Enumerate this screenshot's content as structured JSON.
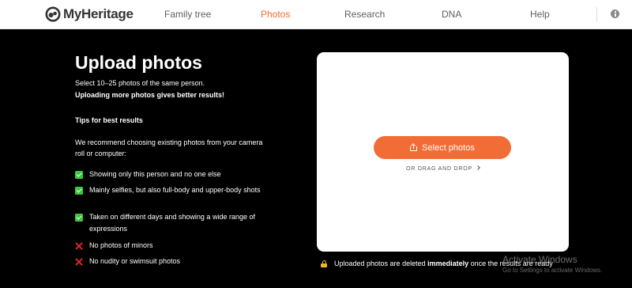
{
  "header": {
    "logo_text": "MyHeritage",
    "nav": [
      {
        "label": "Family tree"
      },
      {
        "label": "Photos",
        "active": true
      },
      {
        "label": "Research"
      },
      {
        "label": "DNA"
      },
      {
        "label": "Help"
      }
    ],
    "icons": {
      "logo": "myheritage-logo-icon",
      "info": "info-icon"
    }
  },
  "intro": {
    "title": "Upload photos",
    "subtitle": "Select 10–25 photos of the same person.",
    "subtitle_bold": "Uploading more photos gives better results!"
  },
  "tips": {
    "heading": "Tips for best results",
    "recommendation": "We recommend choosing existing photos from your camera roll or computer:",
    "dos": [
      {
        "text": "Showing only this person and no one else",
        "icon": "check-icon"
      },
      {
        "text": "Mainly selfies, but also full-body and upper-body shots",
        "icon": "check-icon"
      },
      {
        "text": "Taken on different days and showing a wide range of expressions",
        "icon": "check-icon"
      }
    ],
    "donts": [
      {
        "text": "No photos of minors",
        "icon": "cross-icon"
      },
      {
        "text": "No nudity or swimsuit photos",
        "icon": "cross-icon"
      }
    ]
  },
  "upload_card": {
    "button_label": "Select photos",
    "button_icon": "share-icon",
    "drag_drop": "OR DRAG AND DROP"
  },
  "notice": {
    "icon": "lock-icon",
    "before": "Uploaded photos are deleted ",
    "bold": "immediately",
    "after": " once the results are ready"
  },
  "watermark": {
    "title": "Activate Windows",
    "subtitle": "Go to Settings to activate Windows."
  },
  "colors": {
    "accent": "#f26c36",
    "background": "#000000",
    "check": "#3fc53f",
    "cross": "#e3242b",
    "lock": "#f0b429"
  }
}
